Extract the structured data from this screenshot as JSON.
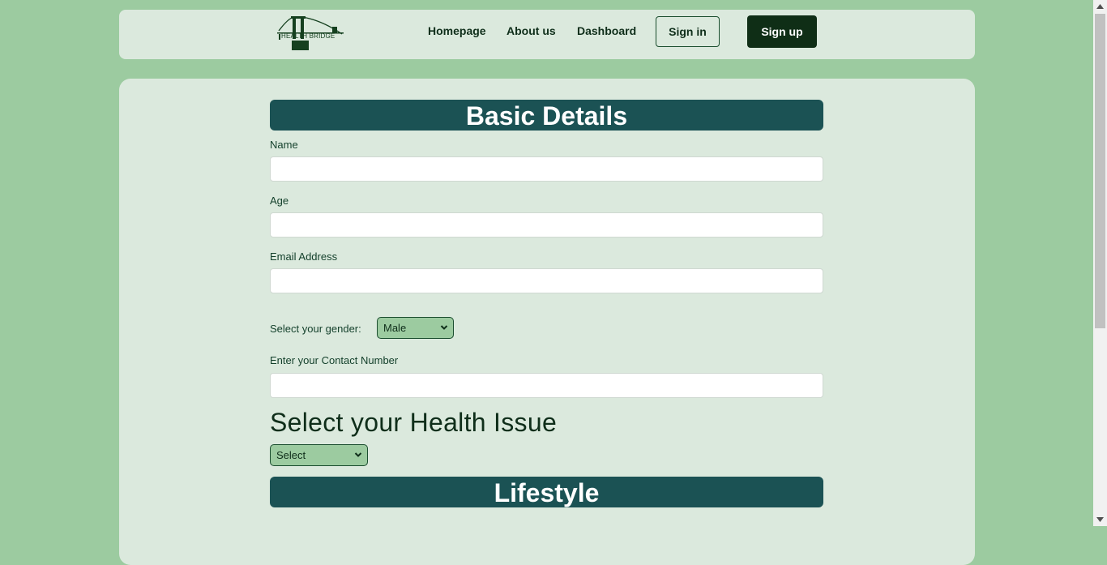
{
  "brand": {
    "logo_text": "HEALTH BRIDGE"
  },
  "nav": {
    "links": [
      "Homepage",
      "About us",
      "Dashboard"
    ],
    "sign_in": "Sign in",
    "sign_up": "Sign up"
  },
  "basic_details": {
    "title": "Basic Details",
    "name_label": "Name",
    "age_label": "Age",
    "email_label": "Email Address",
    "gender_label": "Select your gender:",
    "gender_value": "Male",
    "contact_label": "Enter your Contact Number"
  },
  "health": {
    "title": "Select your Health Issue",
    "select_value": "Select"
  },
  "lifestyle": {
    "title": "Lifestyle"
  },
  "colors": {
    "page_bg": "#9ccba0",
    "card_bg": "#dbe9dd",
    "header_bg": "#1b5254",
    "signup_bg": "#0f2e16"
  }
}
